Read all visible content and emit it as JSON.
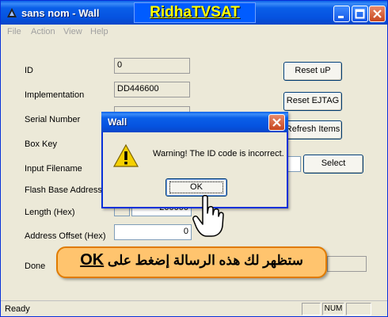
{
  "window": {
    "title": "sans nom - Wall",
    "brand": "RidhaTVSAT"
  },
  "menu": [
    "File",
    "Action",
    "View",
    "Help"
  ],
  "form": {
    "id_label": "ID",
    "id_value": "0",
    "implementation_label": "Implementation",
    "implementation_value": "DD446600",
    "serial_label": "Serial Number",
    "boxkey_label": "Box Key",
    "input_filename_label": "Input Filename",
    "flash_base_label": "Flash Base Address",
    "length_label": "Length (Hex)",
    "length_value": "200000",
    "address_offset_label": "Address Offset (Hex)",
    "address_offset_value": "0",
    "done_label": "Done"
  },
  "buttons": {
    "reset_up": "Reset uP",
    "reset_ejtag": "Reset EJTAG",
    "refresh_items": "Refresh Items",
    "select": "Select"
  },
  "dialog": {
    "title": "Wall",
    "message": "Warning! The ID code is incorrect.",
    "ok_label": "OK"
  },
  "banner": {
    "text": "ستظهر لك هذه الرسالة إضغط على",
    "ok": "OK"
  },
  "status": {
    "text": "Ready",
    "num": "NUM"
  },
  "colors": {
    "titlebar": "#0553e0",
    "brand_text": "#ffff00",
    "banner_bg": "#ffc46e",
    "warning": "#f5d000"
  },
  "icons": [
    "app-icon",
    "minimize-icon",
    "maximize-icon",
    "close-icon",
    "warning-icon",
    "hand-cursor-icon"
  ]
}
